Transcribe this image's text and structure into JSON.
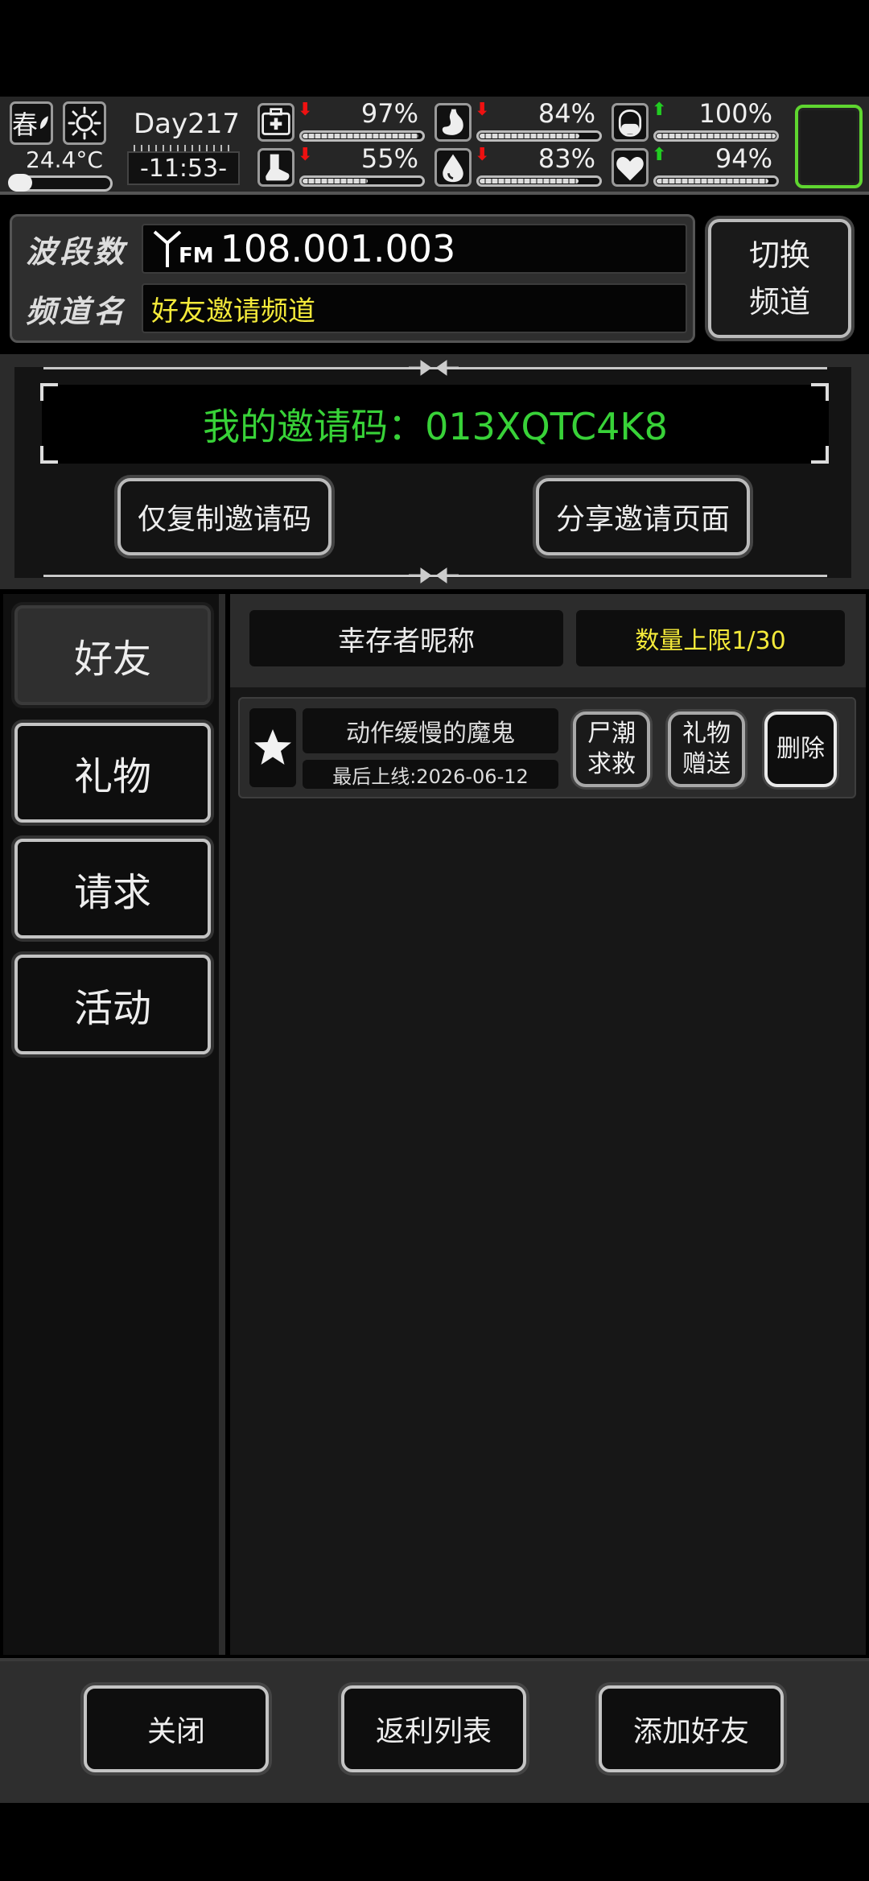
{
  "status": {
    "season": "春",
    "temperature": "24.4°C",
    "day": "Day217",
    "clock": "-11:53-",
    "stats": [
      {
        "name": "health",
        "icon": "medkit-icon",
        "trend": "down",
        "value": "97%",
        "level": 0.97
      },
      {
        "name": "hunger",
        "icon": "stomach-icon",
        "trend": "down",
        "value": "84%",
        "level": 0.84
      },
      {
        "name": "medicine",
        "icon": "pill-icon",
        "trend": "up",
        "value": "100%",
        "level": 1.0
      },
      {
        "name": "stamina",
        "icon": "foot-icon",
        "trend": "down",
        "value": "55%",
        "level": 0.55
      },
      {
        "name": "thirst",
        "icon": "water-drop-icon",
        "trend": "down",
        "value": "83%",
        "level": 0.83
      },
      {
        "name": "mood",
        "icon": "heart-icon",
        "trend": "up",
        "value": "94%",
        "level": 0.94
      }
    ]
  },
  "radio": {
    "band_label": "波段数",
    "channel_label": "频道名",
    "frequency_prefix": "FM",
    "frequency": "108.001.003",
    "channel_name": "好友邀请频道",
    "switch_line1": "切换",
    "switch_line2": "频道"
  },
  "invite": {
    "code_text": "我的邀请码：013XQTC4K8",
    "copy_button": "仅复制邀请码",
    "share_button": "分享邀请页面"
  },
  "tabs": [
    {
      "label": "好友",
      "active": true
    },
    {
      "label": "礼物",
      "active": false
    },
    {
      "label": "请求",
      "active": false
    },
    {
      "label": "活动",
      "active": false
    }
  ],
  "friends_list": {
    "column_nickname": "幸存者昵称",
    "limit_text": "数量上限1/30",
    "rows": [
      {
        "nickname": "动作缓慢的魔鬼",
        "last_online": "最后上线:2026-06-12",
        "btn_rescue_1": "尸潮",
        "btn_rescue_2": "求救",
        "btn_gift_1": "礼物",
        "btn_gift_2": "赠送",
        "btn_delete": "删除"
      }
    ]
  },
  "bottom": {
    "close": "关闭",
    "rebate_list": "返利列表",
    "add_friend": "添加好友"
  },
  "colors": {
    "accent_green": "#38d238",
    "highlight_yellow": "#f4ea3a",
    "slot_border": "#5fd630",
    "trend_down": "#e11111",
    "trend_up": "#22cc22"
  }
}
